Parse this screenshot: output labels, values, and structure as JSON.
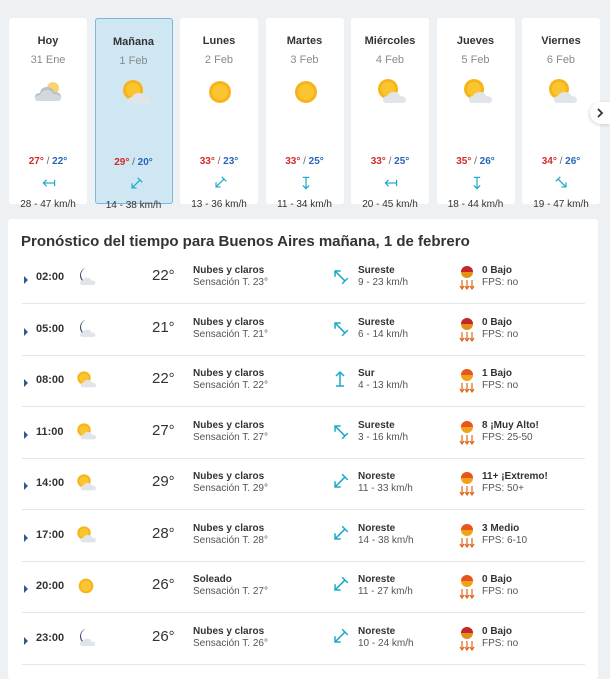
{
  "colors": {
    "max_temp": "#d42a2a",
    "min_temp": "#2766b8",
    "wind_arrow": "#1aa9c8",
    "selected_bg": "#cfe6f3",
    "selected_border": "#79b7de"
  },
  "days": [
    {
      "name": "Hoy",
      "date": "31 Ene",
      "icon": "cloudy-icon",
      "max": "27°",
      "sep": "/",
      "min": "22°",
      "wind_icon": "wind-arrow-west-icon",
      "wind": "28 - 47 km/h",
      "selected": false
    },
    {
      "name": "Mañana",
      "date": "1 Feb",
      "icon": "sun-cloud-icon",
      "max": "29°",
      "sep": "/",
      "min": "20°",
      "wind_icon": "wind-arrow-southwest-icon",
      "wind": "14 - 38 km/h",
      "selected": true
    },
    {
      "name": "Lunes",
      "date": "2 Feb",
      "icon": "sun-icon",
      "max": "33°",
      "sep": "/",
      "min": "23°",
      "wind_icon": "wind-arrow-southwest-icon",
      "wind": "13 - 36 km/h",
      "selected": false
    },
    {
      "name": "Martes",
      "date": "3 Feb",
      "icon": "sun-icon",
      "max": "33°",
      "sep": "/",
      "min": "25°",
      "wind_icon": "wind-arrow-south-icon",
      "wind": "11 - 34 km/h",
      "selected": false
    },
    {
      "name": "Miércoles",
      "date": "4 Feb",
      "icon": "sun-cloud-icon",
      "max": "33°",
      "sep": "/",
      "min": "25°",
      "wind_icon": "wind-arrow-west-icon",
      "wind": "20 - 45 km/h",
      "selected": false
    },
    {
      "name": "Jueves",
      "date": "5 Feb",
      "icon": "sun-cloud-icon",
      "max": "35°",
      "sep": "/",
      "min": "26°",
      "wind_icon": "wind-arrow-south-icon",
      "wind": "18 - 44 km/h",
      "selected": false
    },
    {
      "name": "Viernes",
      "date": "6 Feb",
      "icon": "sun-cloud-icon",
      "max": "34°",
      "sep": "/",
      "min": "26°",
      "wind_icon": "wind-arrow-southeast-icon",
      "wind": "19 - 47 km/h",
      "selected": false
    }
  ],
  "next_icon": "chevron-right-icon",
  "forecast": {
    "title": "Pronóstico del tiempo para Buenos Aires mañana, 1 de febrero",
    "rows": [
      {
        "time": "02:00",
        "sky": "moon-cloud-icon",
        "temp": "22°",
        "desc": "Nubes y claros",
        "feel": "Sensación T. 23°",
        "wind_icon": "arrow-northwest-icon",
        "wind_dir": "Sureste",
        "wind_speed": "9 - 23 km/h",
        "uv_icon": "uv-night-icon",
        "uv": "0 Bajo",
        "fps": "FPS: no"
      },
      {
        "time": "05:00",
        "sky": "moon-cloud-icon",
        "temp": "21°",
        "desc": "Nubes y claros",
        "feel": "Sensación T. 21°",
        "wind_icon": "arrow-northwest-icon",
        "wind_dir": "Sureste",
        "wind_speed": "6 - 14 km/h",
        "uv_icon": "uv-night-icon",
        "uv": "0 Bajo",
        "fps": "FPS: no"
      },
      {
        "time": "08:00",
        "sky": "sun-cloud-icon",
        "temp": "22°",
        "desc": "Nubes y claros",
        "feel": "Sensación T. 22°",
        "wind_icon": "arrow-north-icon",
        "wind_dir": "Sur",
        "wind_speed": "4 - 13 km/h",
        "uv_icon": "uv-sun-icon",
        "uv": "1 Bajo",
        "fps": "FPS: no"
      },
      {
        "time": "11:00",
        "sky": "sun-cloud-icon",
        "temp": "27°",
        "desc": "Nubes y claros",
        "feel": "Sensación T. 27°",
        "wind_icon": "arrow-northwest-icon",
        "wind_dir": "Sureste",
        "wind_speed": "3 - 16 km/h",
        "uv_icon": "uv-sun-icon",
        "uv": "8 ¡Muy Alto!",
        "fps": "FPS: 25-50"
      },
      {
        "time": "14:00",
        "sky": "sun-cloud-icon",
        "temp": "29°",
        "desc": "Nubes y claros",
        "feel": "Sensación T. 29°",
        "wind_icon": "arrow-southwest-icon",
        "wind_dir": "Noreste",
        "wind_speed": "11 - 33 km/h",
        "uv_icon": "uv-sun-icon",
        "uv": "11+ ¡Extremo!",
        "fps": "FPS: 50+"
      },
      {
        "time": "17:00",
        "sky": "sun-cloud-icon",
        "temp": "28°",
        "desc": "Nubes y claros",
        "feel": "Sensación T. 28°",
        "wind_icon": "arrow-southwest-icon",
        "wind_dir": "Noreste",
        "wind_speed": "14 - 38 km/h",
        "uv_icon": "uv-sun-icon",
        "uv": "3 Medio",
        "fps": "FPS: 6-10"
      },
      {
        "time": "20:00",
        "sky": "sun-icon",
        "temp": "26°",
        "desc": "Soleado",
        "feel": "Sensación T. 27°",
        "wind_icon": "arrow-southwest-icon",
        "wind_dir": "Noreste",
        "wind_speed": "11 - 27 km/h",
        "uv_icon": "uv-sun-icon",
        "uv": "0 Bajo",
        "fps": "FPS: no"
      },
      {
        "time": "23:00",
        "sky": "moon-cloud-icon",
        "temp": "26°",
        "desc": "Nubes y claros",
        "feel": "Sensación T. 26°",
        "wind_icon": "arrow-southwest-icon",
        "wind_dir": "Noreste",
        "wind_speed": "10 - 24 km/h",
        "uv_icon": "uv-night-icon",
        "uv": "0 Bajo",
        "fps": "FPS: no"
      }
    ]
  }
}
